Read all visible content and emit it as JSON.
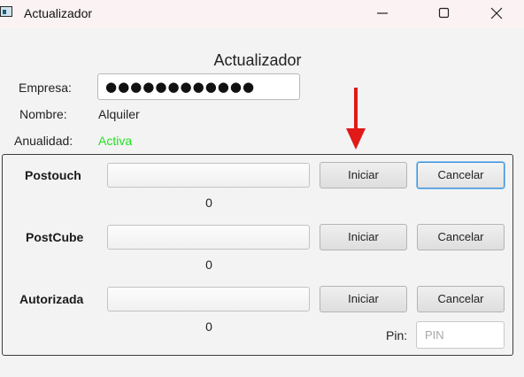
{
  "window": {
    "title": "Actualizador",
    "icons": {
      "app": "app-window-icon",
      "minimize": "minimize-icon",
      "maximize": "maximize-icon",
      "close": "close-icon"
    }
  },
  "header": {
    "title": "Actualizador"
  },
  "fields": {
    "empresa": {
      "label": "Empresa:",
      "value": "●●●●●●●●●●●●"
    },
    "nombre": {
      "label": "Nombre:",
      "value": "Alquiler"
    },
    "anualidad": {
      "label": "Anualidad:",
      "value": "Activa",
      "color": "#1fe31f"
    }
  },
  "rows": [
    {
      "label": "Postouch",
      "progress": 0,
      "count": "0",
      "start_label": "Iniciar",
      "cancel_label": "Cancelar"
    },
    {
      "label": "PostCube",
      "progress": 0,
      "count": "0",
      "start_label": "Iniciar",
      "cancel_label": "Cancelar"
    },
    {
      "label": "Autorizada",
      "progress": 0,
      "count": "0",
      "start_label": "Iniciar",
      "cancel_label": "Cancelar"
    }
  ],
  "pin": {
    "label": "Pin:",
    "placeholder": "PIN",
    "value": ""
  },
  "annotation": {
    "arrow_color": "#e01919"
  }
}
